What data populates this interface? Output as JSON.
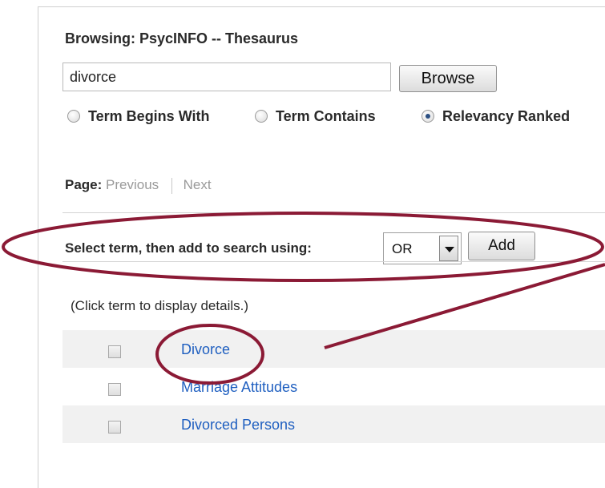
{
  "header": {
    "title": "Browsing: PsycINFO -- Thesaurus"
  },
  "search": {
    "value": "divorce",
    "browse_label": "Browse"
  },
  "options": [
    {
      "label": "Term Begins With",
      "checked": false
    },
    {
      "label": "Term Contains",
      "checked": false
    },
    {
      "label": "Relevancy Ranked",
      "checked": true
    }
  ],
  "pagination": {
    "label": "Page:",
    "previous": "Previous",
    "next": "Next"
  },
  "add_to_search": {
    "label": "Select term, then add to search using:",
    "operator": "OR",
    "add_label": "Add"
  },
  "hint": "(Click term to display details.)",
  "terms": [
    {
      "label": "Divorce"
    },
    {
      "label": "Marriage Attitudes"
    },
    {
      "label": "Divorced Persons"
    }
  ],
  "colors": {
    "link": "#1f5fc0",
    "annotation": "#8b1a35",
    "row_shade": "#f1f1f1"
  },
  "annotation_icons": [
    "ellipse-highlight",
    "pointer-line"
  ]
}
